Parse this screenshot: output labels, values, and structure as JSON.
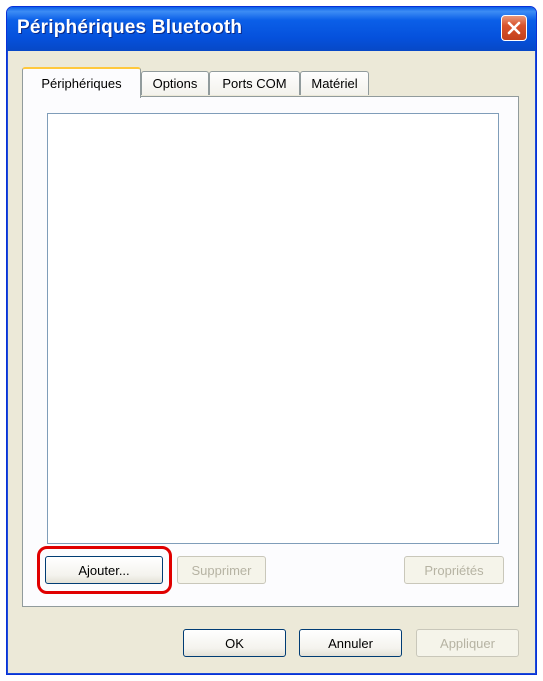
{
  "window": {
    "title": "Périphériques Bluetooth"
  },
  "tabs": [
    {
      "label": "Périphériques",
      "active": true
    },
    {
      "label": "Options",
      "active": false
    },
    {
      "label": "Ports COM",
      "active": false
    },
    {
      "label": "Matériel",
      "active": false
    }
  ],
  "panel": {
    "add_label": "Ajouter...",
    "remove_label": "Supprimer",
    "properties_label": "Propriétés"
  },
  "footer": {
    "ok_label": "OK",
    "cancel_label": "Annuler",
    "apply_label": "Appliquer"
  },
  "colors": {
    "titlebar": "#0551dc",
    "highlight": "#e00000",
    "active_tab_accent": "#ffc83c"
  },
  "icons": {
    "close": "close-icon"
  }
}
